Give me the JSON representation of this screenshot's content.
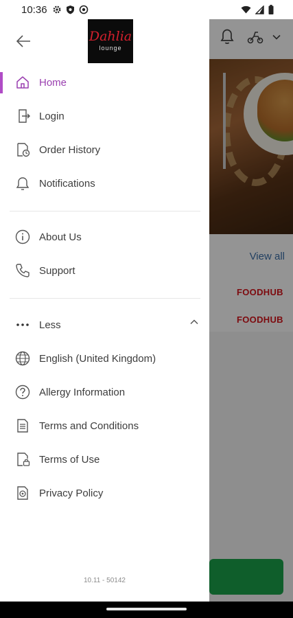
{
  "status_bar": {
    "time": "10:36",
    "left_icons": [
      "gear-icon",
      "shield-icon",
      "target-icon"
    ],
    "right_icons": [
      "wifi-icon",
      "cell-signal-icon",
      "battery-icon"
    ]
  },
  "drawer": {
    "logo": {
      "main": "Dahlia",
      "sub": "lounge"
    },
    "primary_items": [
      {
        "label": "Home",
        "icon": "home-icon",
        "active": true
      },
      {
        "label": "Login",
        "icon": "login-icon"
      },
      {
        "label": "Order History",
        "icon": "order-history-icon"
      },
      {
        "label": "Notifications",
        "icon": "bell-icon"
      }
    ],
    "secondary_items": [
      {
        "label": "About Us",
        "icon": "info-icon"
      },
      {
        "label": "Support",
        "icon": "phone-icon"
      }
    ],
    "less_toggle": {
      "label": "Less",
      "icon": "more-dots-icon",
      "expanded": true
    },
    "more_items": [
      {
        "label": "English (United Kingdom)",
        "icon": "globe-icon"
      },
      {
        "label": "Allergy Information",
        "icon": "help-circle-icon"
      },
      {
        "label": "Terms and Conditions",
        "icon": "document-icon"
      },
      {
        "label": "Terms of Use",
        "icon": "document-lock-icon"
      },
      {
        "label": "Privacy Policy",
        "icon": "privacy-icon"
      }
    ],
    "version": "10.11 - 50142"
  },
  "background": {
    "view_all": "View all",
    "brand_1": "FOODHUB",
    "brand_2": "FOODHUB"
  },
  "colors": {
    "accent": "#9a3fb0",
    "active_bar": "#b04cc6",
    "brand_red": "#d8131b",
    "link_blue": "#3b6ea8",
    "cta_green": "#1aa34a"
  }
}
